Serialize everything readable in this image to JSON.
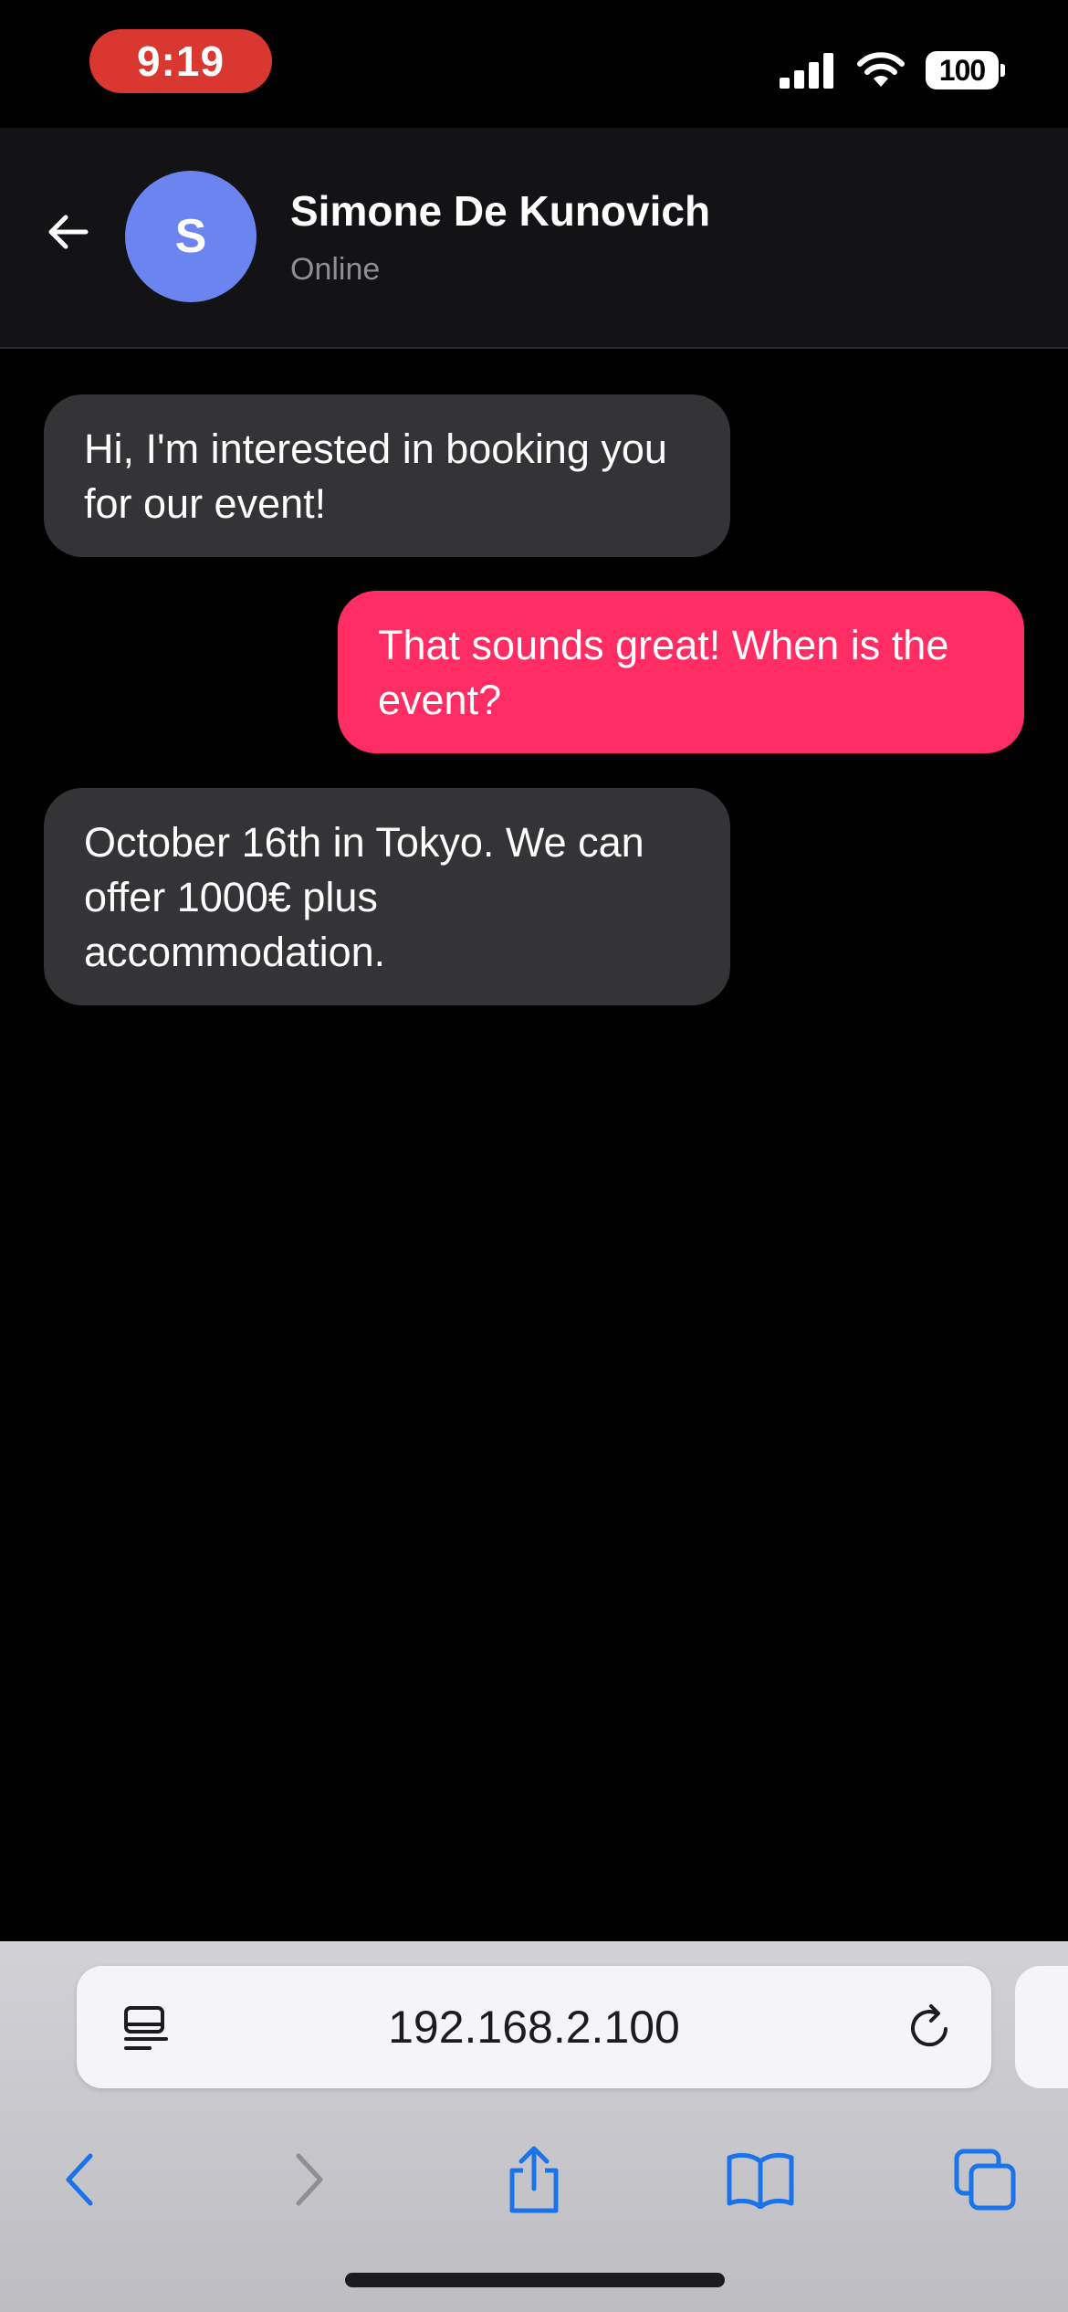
{
  "status_bar": {
    "time": "9:19",
    "battery_level": "100",
    "icons": [
      "cellular-signal-icon",
      "wifi-icon",
      "battery-icon"
    ]
  },
  "chat_header": {
    "contact_name": "Simone De Kunovich",
    "contact_status": "Online",
    "avatar_initial": "S",
    "avatar_color": "#6b84f0",
    "back_icon": "arrow-left-icon"
  },
  "messages": [
    {
      "direction": "received",
      "text": "Hi, I'm interested in booking you for our event!"
    },
    {
      "direction": "sent",
      "text": "That sounds great! When is the event?"
    },
    {
      "direction": "received",
      "text": "October 16th in Tokyo. We can offer 1000€ plus accommodation."
    }
  ],
  "colors": {
    "background": "#000000",
    "header": "#131215",
    "received_bubble": "#343336",
    "sent_bubble": "#ff2d63",
    "status_time_pill": "#d9372f",
    "browser_accent": "#1a73e8"
  },
  "browser": {
    "url": "192.168.2.100",
    "page_icon": "page-menu-icon",
    "reload_icon": "reload-icon",
    "toolbar": [
      "back-icon",
      "forward-icon",
      "share-icon",
      "bookmarks-icon",
      "tabs-icon"
    ]
  }
}
